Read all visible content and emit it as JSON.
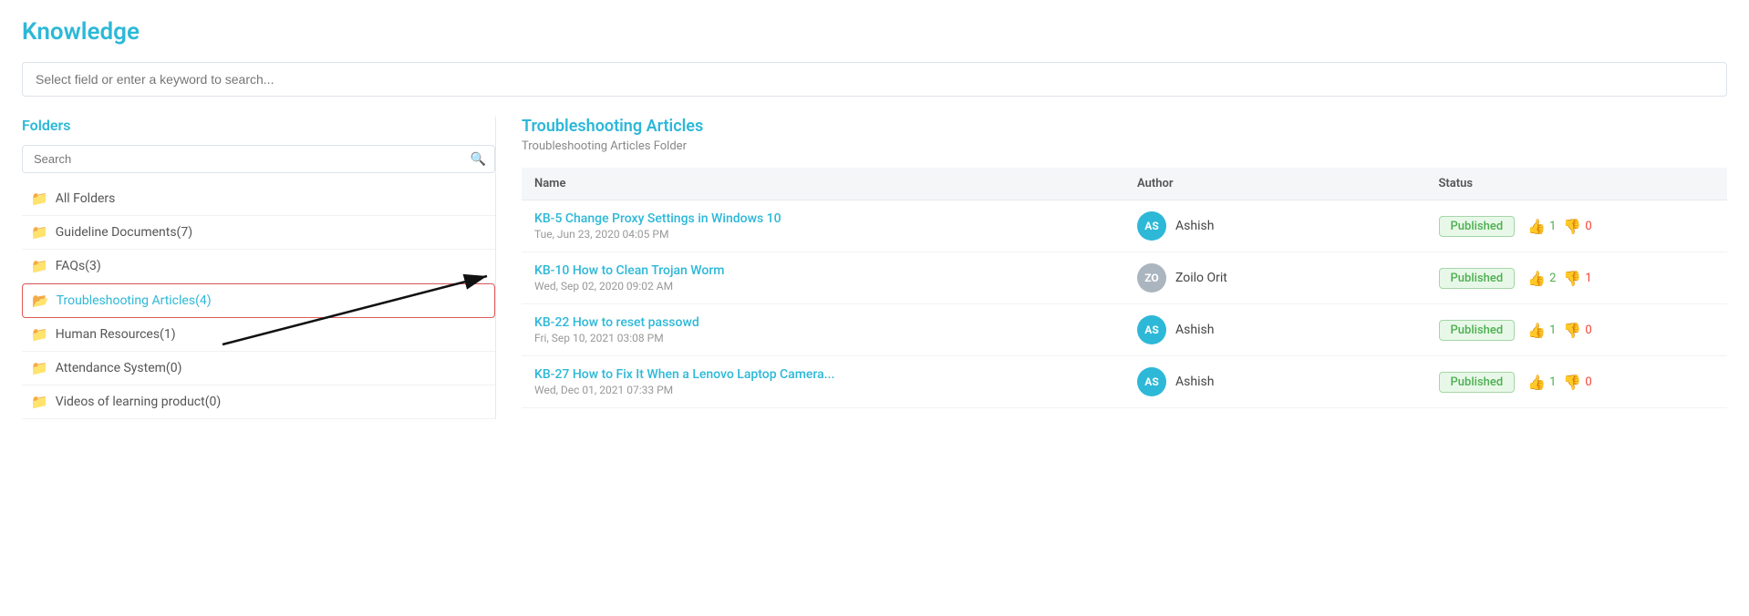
{
  "page": {
    "title": "Knowledge",
    "global_search_placeholder": "Select field or enter a keyword to search..."
  },
  "sidebar": {
    "title": "Folders",
    "search_placeholder": "Search",
    "folders": [
      {
        "id": "all",
        "label": "All Folders",
        "count": null,
        "active": false
      },
      {
        "id": "guideline",
        "label": "Guideline Documents(7)",
        "count": 7,
        "active": false
      },
      {
        "id": "faqs",
        "label": "FAQs(3)",
        "count": 3,
        "active": false
      },
      {
        "id": "troubleshooting",
        "label": "Troubleshooting Articles(4)",
        "count": 4,
        "active": true
      },
      {
        "id": "hr",
        "label": "Human Resources(1)",
        "count": 1,
        "active": false
      },
      {
        "id": "attendance",
        "label": "Attendance System(0)",
        "count": 0,
        "active": false
      },
      {
        "id": "videos",
        "label": "Videos of learning product(0)",
        "count": 0,
        "active": false
      }
    ]
  },
  "content": {
    "title": "Troubleshooting Articles",
    "subtitle": "Troubleshooting Articles Folder",
    "table": {
      "columns": [
        "Name",
        "Author",
        "Status"
      ],
      "rows": [
        {
          "id": "kb5",
          "name": "KB-5 Change Proxy Settings in Windows 10",
          "date": "Tue, Jun 23, 2020 04:05 PM",
          "author": "Ashish",
          "author_initials": "AS",
          "avatar_type": "blue",
          "status": "Published",
          "votes_up": 1,
          "votes_down": 0
        },
        {
          "id": "kb10",
          "name": "KB-10 How to Clean Trojan Worm",
          "date": "Wed, Sep 02, 2020 09:02 AM",
          "author": "Zoilo Orit",
          "author_initials": "ZO",
          "avatar_type": "gray",
          "status": "Published",
          "votes_up": 2,
          "votes_down": 1
        },
        {
          "id": "kb22",
          "name": "KB-22 How to reset passowd",
          "date": "Fri, Sep 10, 2021 03:08 PM",
          "author": "Ashish",
          "author_initials": "AS",
          "avatar_type": "blue",
          "status": "Published",
          "votes_up": 1,
          "votes_down": 0
        },
        {
          "id": "kb27",
          "name": "KB-27 How to Fix It When a Lenovo Laptop Camera...",
          "date": "Wed, Dec 01, 2021 07:33 PM",
          "author": "Ashish",
          "author_initials": "AS",
          "avatar_type": "blue",
          "status": "Published",
          "votes_up": 1,
          "votes_down": 0
        }
      ]
    }
  }
}
